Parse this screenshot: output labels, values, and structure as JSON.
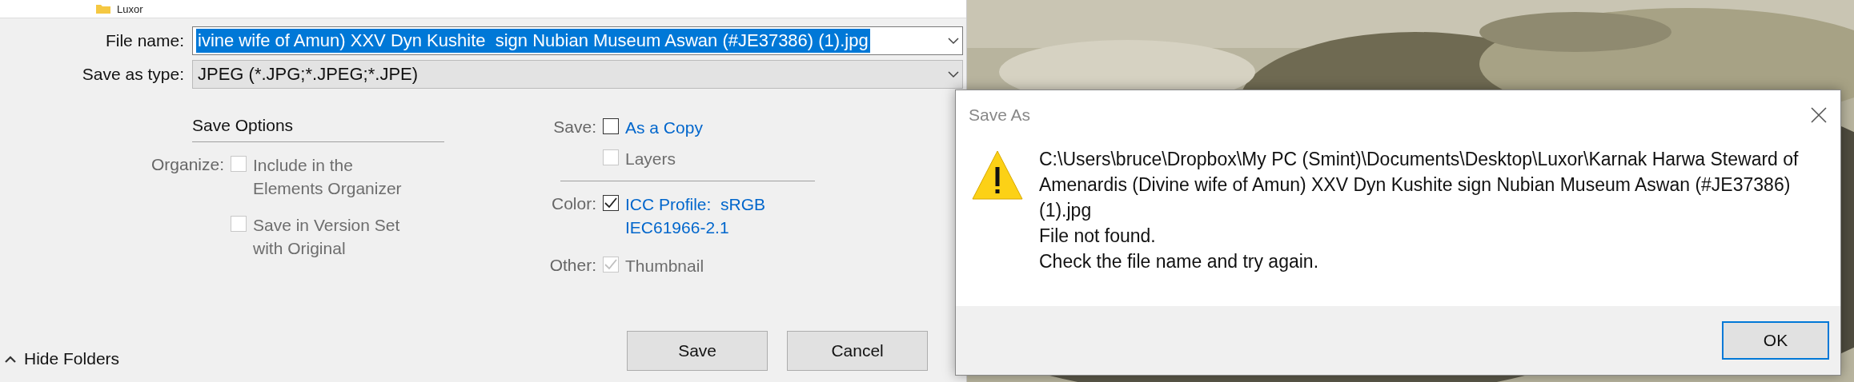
{
  "folder_item": {
    "label": "Luxor"
  },
  "file_name": {
    "label": "File name:",
    "value": "ivine wife of Amun) XXV Dyn Kushite  sign Nubian Museum Aswan (#JE37386) (1).jpg",
    "selected": true
  },
  "save_as_type": {
    "label": "Save as type:",
    "value": "JPEG (*.JPG;*.JPEG;*.JPE)"
  },
  "save_options": {
    "heading": "Save Options",
    "left_groups": [
      {
        "label": "Organize:",
        "options": [
          {
            "label": "Include in the Elements Organizer",
            "checked": false,
            "disabled": true
          },
          {
            "label": "Save in Version Set with Original",
            "checked": false,
            "disabled": true
          }
        ]
      }
    ],
    "right_groups": [
      {
        "label": "Save:",
        "options": [
          {
            "label": "As a Copy",
            "checked": false,
            "disabled": false
          },
          {
            "label": "Layers",
            "checked": false,
            "disabled": true
          }
        ]
      },
      {
        "label": "Color:",
        "options": [
          {
            "label": "ICC Profile:  sRGB IEC61966-2.1",
            "checked": true,
            "disabled": false
          }
        ]
      },
      {
        "label": "Other:",
        "options": [
          {
            "label": "Thumbnail",
            "checked": true,
            "disabled": true
          }
        ]
      }
    ]
  },
  "hide_folders": {
    "label": "Hide Folders"
  },
  "buttons": [
    {
      "label": "Save"
    },
    {
      "label": "Cancel"
    }
  ],
  "alert": {
    "title": "Save As",
    "path": "C:\\Users\\bruce\\Dropbox\\My PC (Smint)\\Documents\\Desktop\\Luxor\\Karnak Harwa Steward of Amenardis (Divine wife of Amun) XXV Dyn Kushite  sign Nubian Museum Aswan (#JE37386) (1).jpg",
    "lines": [
      "File not found.",
      "Check the file name and try again."
    ],
    "button": "OK"
  }
}
